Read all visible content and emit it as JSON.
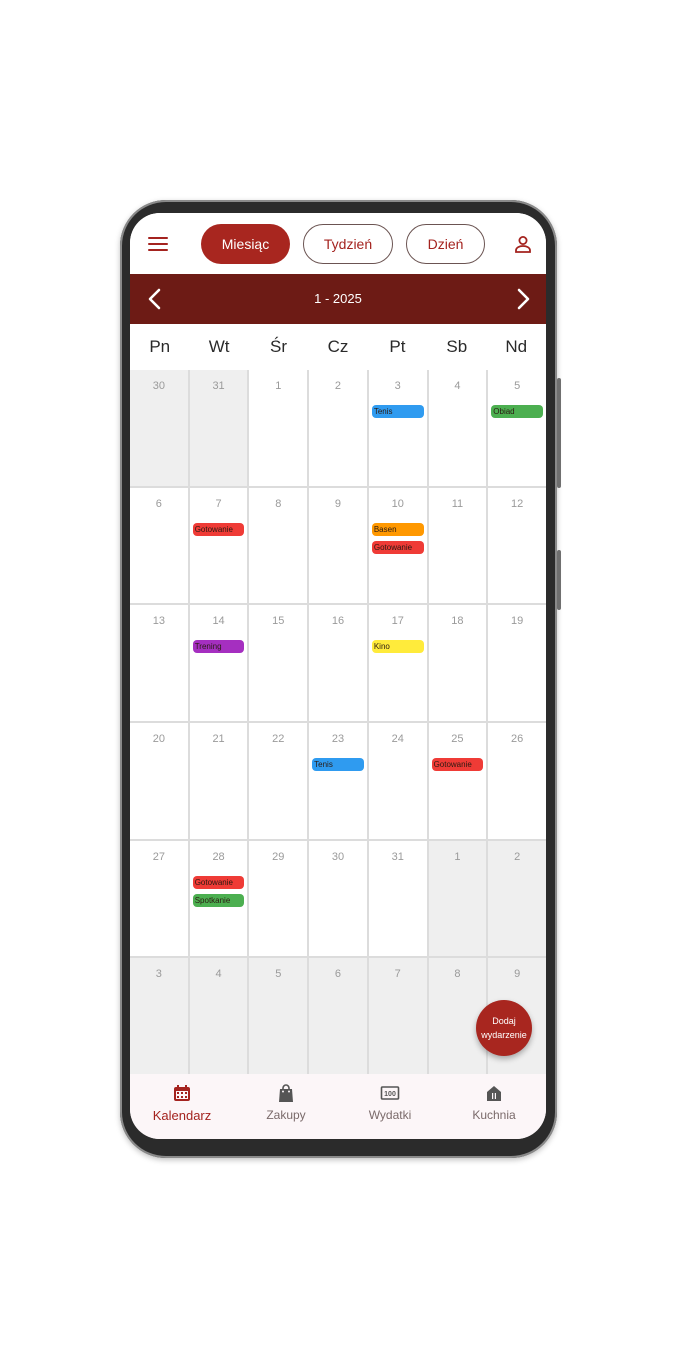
{
  "topbar": {
    "tabs": [
      {
        "label": "Miesiąc",
        "active": true
      },
      {
        "label": "Tydzień",
        "active": false
      },
      {
        "label": "Dzień",
        "active": false
      }
    ]
  },
  "calendar": {
    "month_label": "1 - 2025",
    "weekdays": [
      "Pn",
      "Wt",
      "Śr",
      "Cz",
      "Pt",
      "Sb",
      "Nd"
    ],
    "days": [
      {
        "num": "30",
        "other": true,
        "events": []
      },
      {
        "num": "31",
        "other": true,
        "events": []
      },
      {
        "num": "1",
        "other": false,
        "events": []
      },
      {
        "num": "2",
        "other": false,
        "events": []
      },
      {
        "num": "3",
        "other": false,
        "events": [
          {
            "label": "Tenis",
            "color": "#2f9bf0"
          }
        ]
      },
      {
        "num": "4",
        "other": false,
        "events": []
      },
      {
        "num": "5",
        "other": false,
        "events": [
          {
            "label": "Obiad",
            "color": "#4caf50"
          }
        ]
      },
      {
        "num": "6",
        "other": false,
        "events": []
      },
      {
        "num": "7",
        "other": false,
        "events": [
          {
            "label": "Gotowanie",
            "color": "#ef3b36"
          }
        ]
      },
      {
        "num": "8",
        "other": false,
        "events": []
      },
      {
        "num": "9",
        "other": false,
        "events": []
      },
      {
        "num": "10",
        "other": false,
        "events": [
          {
            "label": "Basen",
            "color": "#ff9800"
          },
          {
            "label": "Gotowanie",
            "color": "#ef3b36"
          }
        ]
      },
      {
        "num": "11",
        "other": false,
        "events": []
      },
      {
        "num": "12",
        "other": false,
        "events": []
      },
      {
        "num": "13",
        "other": false,
        "events": []
      },
      {
        "num": "14",
        "other": false,
        "events": [
          {
            "label": "Trening",
            "color": "#a52fc0"
          }
        ]
      },
      {
        "num": "15",
        "other": false,
        "events": []
      },
      {
        "num": "16",
        "other": false,
        "events": []
      },
      {
        "num": "17",
        "other": false,
        "events": [
          {
            "label": "Kino",
            "color": "#ffeb3b"
          }
        ]
      },
      {
        "num": "18",
        "other": false,
        "events": []
      },
      {
        "num": "19",
        "other": false,
        "events": []
      },
      {
        "num": "20",
        "other": false,
        "events": []
      },
      {
        "num": "21",
        "other": false,
        "events": []
      },
      {
        "num": "22",
        "other": false,
        "events": []
      },
      {
        "num": "23",
        "other": false,
        "events": [
          {
            "label": "Tenis",
            "color": "#2f9bf0"
          }
        ]
      },
      {
        "num": "24",
        "other": false,
        "events": []
      },
      {
        "num": "25",
        "other": false,
        "events": [
          {
            "label": "Gotowanie",
            "color": "#ef3b36"
          }
        ]
      },
      {
        "num": "26",
        "other": false,
        "events": []
      },
      {
        "num": "27",
        "other": false,
        "events": []
      },
      {
        "num": "28",
        "other": false,
        "events": [
          {
            "label": "Gotowanie",
            "color": "#ef3b36"
          },
          {
            "label": "Spotkanie",
            "color": "#4caf50"
          }
        ]
      },
      {
        "num": "29",
        "other": false,
        "events": []
      },
      {
        "num": "30",
        "other": false,
        "events": []
      },
      {
        "num": "31",
        "other": false,
        "events": []
      },
      {
        "num": "1",
        "other": true,
        "events": []
      },
      {
        "num": "2",
        "other": true,
        "events": []
      },
      {
        "num": "3",
        "other": true,
        "events": []
      },
      {
        "num": "4",
        "other": true,
        "events": []
      },
      {
        "num": "5",
        "other": true,
        "events": []
      },
      {
        "num": "6",
        "other": true,
        "events": []
      },
      {
        "num": "7",
        "other": true,
        "events": []
      },
      {
        "num": "8",
        "other": true,
        "events": []
      },
      {
        "num": "9",
        "other": true,
        "events": []
      }
    ]
  },
  "fab": {
    "line1": "Dodaj",
    "line2": "wydarzenie"
  },
  "bottom_nav": [
    {
      "label": "Kalendarz",
      "icon": "calendar-icon",
      "active": true
    },
    {
      "label": "Zakupy",
      "icon": "shopping-bag-icon",
      "active": false
    },
    {
      "label": "Wydatki",
      "icon": "money-icon",
      "active": false
    },
    {
      "label": "Kuchnia",
      "icon": "kitchen-icon",
      "active": false
    }
  ],
  "colors": {
    "primary": "#a8261f",
    "month_bar": "#6d1b15"
  }
}
